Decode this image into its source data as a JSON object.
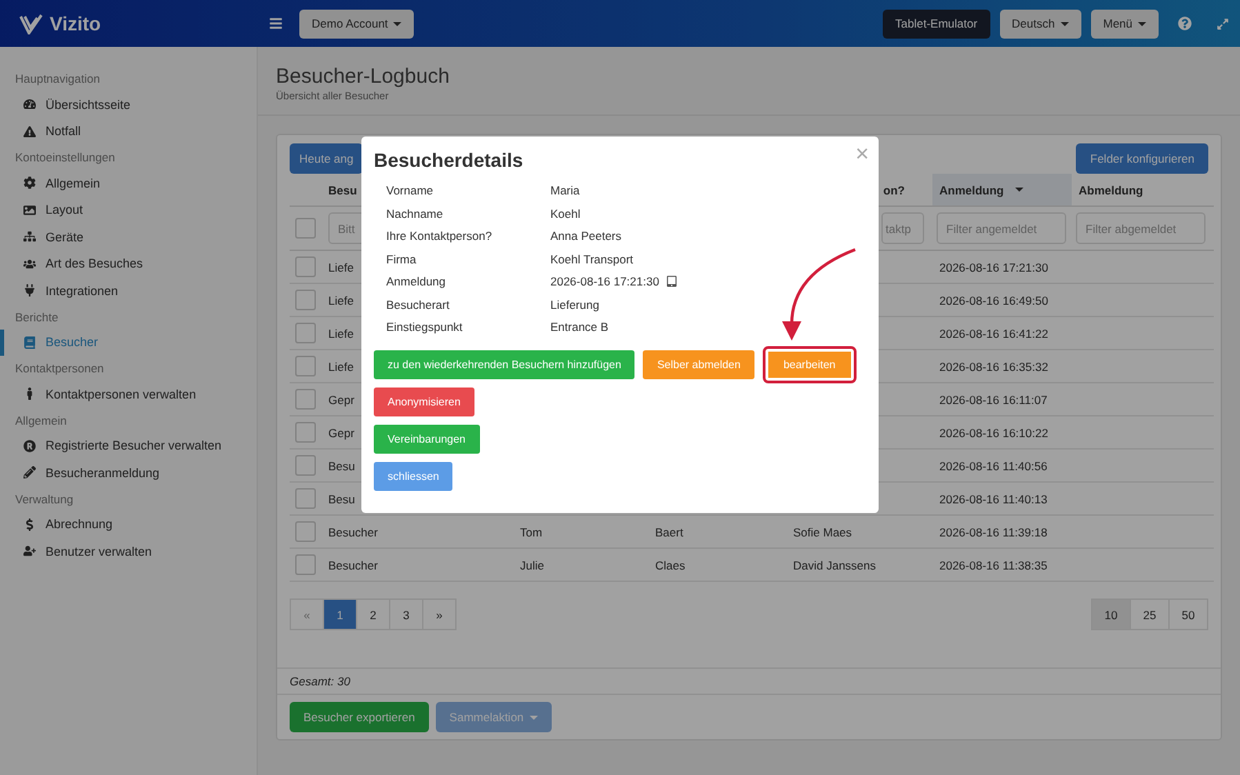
{
  "topbar": {
    "brand": "Vizito",
    "account_button": "Demo Account",
    "buttons": [
      {
        "label": "Tablet-Emulator",
        "kind": "dark",
        "dropdown": false
      },
      {
        "label": "Deutsch",
        "kind": "light",
        "dropdown": true
      },
      {
        "label": "Menü",
        "kind": "light",
        "dropdown": true
      }
    ]
  },
  "sidebar": {
    "sections": [
      {
        "title": "Hauptnavigation",
        "items": [
          {
            "label": "Übersichtsseite",
            "selected": false
          },
          {
            "label": "Notfall",
            "selected": false
          }
        ]
      },
      {
        "title": "Kontoeinstellungen",
        "items": [
          {
            "label": "Allgemein",
            "selected": false
          },
          {
            "label": "Layout",
            "selected": false
          },
          {
            "label": "Geräte",
            "selected": false
          },
          {
            "label": "Art des Besuches",
            "selected": false
          },
          {
            "label": "Integrationen",
            "selected": false
          }
        ]
      },
      {
        "title": "Berichte",
        "items": [
          {
            "label": "Besucher",
            "selected": true
          }
        ]
      },
      {
        "title": "Kontaktpersonen",
        "items": [
          {
            "label": "Kontaktpersonen verwalten",
            "selected": false
          }
        ]
      },
      {
        "title": "Allgemein",
        "items": [
          {
            "label": "Registrierte Besucher verwalten",
            "selected": false
          },
          {
            "label": "Besucheranmeldung",
            "selected": false
          }
        ]
      },
      {
        "title": "Verwaltung",
        "items": [
          {
            "label": "Abrechnung",
            "selected": false
          },
          {
            "label": "Benutzer verwalten",
            "selected": false
          }
        ]
      }
    ]
  },
  "page": {
    "title": "Besucher-Logbuch",
    "subtitle": "Übersicht aller Besucher"
  },
  "toolbar": {
    "left_button": "Heute ang",
    "right_button": "Felder konfigurieren"
  },
  "table": {
    "header": {
      "column_1": "Besu",
      "column_4": "on?",
      "anmeldung": {
        "label": "Anmeldung",
        "sorted": true
      },
      "abmeldung": "Abmeldung"
    },
    "filters": {
      "select_all_checked": false,
      "column_1": {
        "placeholder": "Bitt"
      },
      "column_4": {
        "placeholder": "taktp"
      },
      "anmeldung": {
        "placeholder": "Filter angemeldet"
      },
      "abmeldung": {
        "placeholder": "Filter abgemeldet"
      }
    },
    "rows": [
      {
        "checked": false,
        "column_1": "Liefe",
        "anmeldung": "2026-08-16 17:21:30"
      },
      {
        "checked": false,
        "column_1": "Liefe",
        "anmeldung": "2026-08-16 16:49:50"
      },
      {
        "checked": false,
        "column_1": "Liefe",
        "anmeldung": "2026-08-16 16:41:22"
      },
      {
        "checked": false,
        "column_1": "Liefe",
        "anmeldung": "2026-08-16 16:35:32"
      },
      {
        "checked": false,
        "column_1": "Gepr",
        "anmeldung": "2026-08-16 16:11:07"
      },
      {
        "checked": false,
        "column_1": "Gepr",
        "anmeldung": "2026-08-16 16:10:22"
      },
      {
        "checked": false,
        "column_1": "Besu",
        "anmeldung": "2026-08-16 11:40:56"
      },
      {
        "checked": false,
        "column_1": "Besu",
        "anmeldung": "2026-08-16 11:40:13"
      },
      {
        "checked": false,
        "column_1": "Besucher",
        "vorname": "Tom",
        "nachname": "Baert",
        "kontaktperson": "Sofie Maes",
        "anmeldung": "2026-08-16 11:39:18"
      },
      {
        "checked": false,
        "column_1": "Besucher",
        "vorname": "Julie",
        "nachname": "Claes",
        "kontaktperson": "David Janssens",
        "anmeldung": "2026-08-16 11:38:35"
      }
    ]
  },
  "pagination": [
    {
      "label": "«",
      "selected": false,
      "disabled": true
    },
    {
      "label": "1",
      "selected": true,
      "disabled": false
    },
    {
      "label": "2",
      "selected": false,
      "disabled": false
    },
    {
      "label": "3",
      "selected": false,
      "disabled": false
    },
    {
      "label": "»",
      "selected": false,
      "disabled": false
    }
  ],
  "page_sizes": [
    {
      "label": "10",
      "selected": true
    },
    {
      "label": "25",
      "selected": false
    },
    {
      "label": "50",
      "selected": false
    }
  ],
  "total": "Gesamt: 30",
  "footer_buttons": [
    {
      "label": "Besucher exportieren",
      "kind": "success",
      "disabled": false,
      "dropdown": false
    },
    {
      "label": "Sammelaktion",
      "kind": "primary",
      "disabled": true,
      "dropdown": true
    }
  ],
  "modal": {
    "title": "Besucherdetails",
    "close": "×",
    "details": [
      {
        "label": "Vorname",
        "value": "Maria",
        "device_icon": false
      },
      {
        "label": "Nachname",
        "value": "Koehl",
        "device_icon": false
      },
      {
        "label": "Ihre Kontaktperson?",
        "value": "Anna Peeters",
        "device_icon": false
      },
      {
        "label": "Firma",
        "value": "Koehl Transport",
        "device_icon": false
      },
      {
        "label": "Anmeldung",
        "value": "2026-08-16 17:21:30",
        "device_icon": true
      },
      {
        "label": "Besucherart",
        "value": "Lieferung",
        "device_icon": false
      },
      {
        "label": "Einstiegspunkt",
        "value": "Entrance B",
        "device_icon": false
      }
    ],
    "buttons": [
      [
        {
          "label": "zu den wiederkehrenden Besuchern hinzufügen",
          "kind": "success",
          "highlighted": false
        },
        {
          "label": "Selber abmelden",
          "kind": "warning",
          "highlighted": false
        },
        {
          "label": "bearbeiten",
          "kind": "warning",
          "highlighted": true
        }
      ],
      [
        {
          "label": "Anonymisieren",
          "kind": "danger",
          "highlighted": false
        }
      ],
      [
        {
          "label": "Vereinbarungen",
          "kind": "success",
          "highlighted": false
        }
      ],
      [
        {
          "label": "schliessen",
          "kind": "info",
          "highlighted": false
        }
      ]
    ]
  }
}
